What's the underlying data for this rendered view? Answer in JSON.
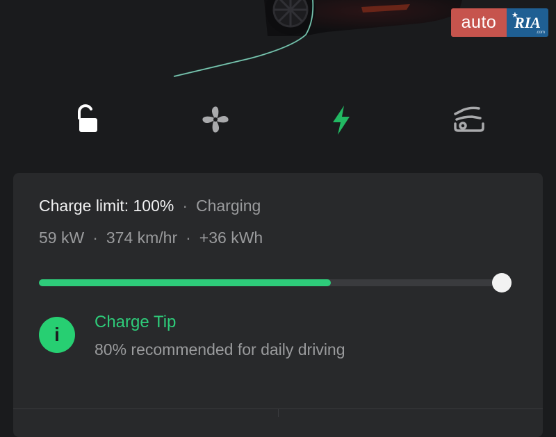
{
  "watermark": {
    "left": "auto",
    "right": "RIA",
    "sub": ".com"
  },
  "icons": [
    {
      "name": "unlock-icon",
      "color": "#ffffff"
    },
    {
      "name": "fan-icon",
      "color": "#a9aaac"
    },
    {
      "name": "bolt-icon",
      "color": "#22b862"
    },
    {
      "name": "car-hood-icon",
      "color": "#a9aaac"
    }
  ],
  "charge": {
    "limit_label": "Charge limit: 100%",
    "separator": "·",
    "status": "Charging",
    "power": "59 kW",
    "rate": "374 km/hr",
    "energy": "+36 kWh",
    "level_fraction": 0.63,
    "limit_fraction": 1.0
  },
  "tip": {
    "icon": "i",
    "title": "Charge Tip",
    "text": "80% recommended for daily driving"
  },
  "colors": {
    "accent": "#2ecc7a",
    "background": "#1a1b1d",
    "card": "#28292b"
  }
}
